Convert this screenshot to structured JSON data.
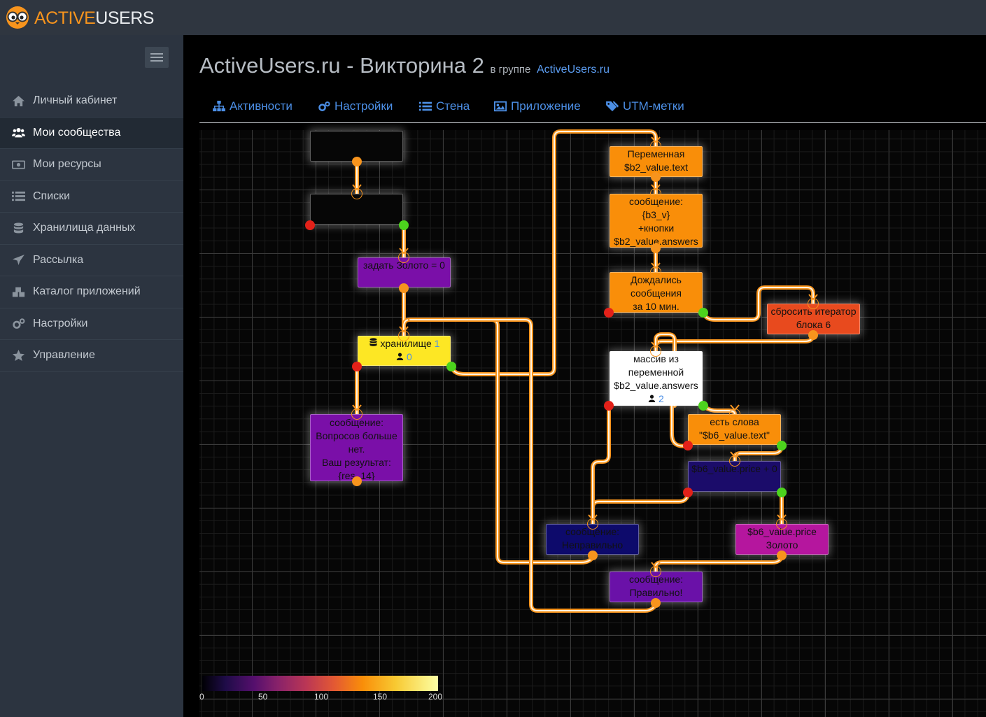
{
  "brand": {
    "part1": "ACTIVE",
    "part2": "USERS"
  },
  "sidebar": {
    "items": [
      {
        "label": "Личный кабинет",
        "icon": "home-icon",
        "active": false
      },
      {
        "label": "Мои сообщества",
        "icon": "users-icon",
        "active": true
      },
      {
        "label": "Мои ресурсы",
        "icon": "money-icon",
        "active": false
      },
      {
        "label": "Списки",
        "icon": "list-icon",
        "active": false
      },
      {
        "label": "Хранилища данных",
        "icon": "database-icon",
        "active": false
      },
      {
        "label": "Рассылка",
        "icon": "plane-icon",
        "active": false
      },
      {
        "label": "Каталог приложений",
        "icon": "cubes-icon",
        "active": false
      },
      {
        "label": "Настройки",
        "icon": "gears-icon",
        "active": false
      },
      {
        "label": "Управление",
        "icon": "star-icon",
        "active": false
      }
    ]
  },
  "header": {
    "title": "ActiveUsers.ru - Викторина 2",
    "group_prefix": "в группе",
    "group_link": "ActiveUsers.ru"
  },
  "tabs": [
    {
      "label": "Активности",
      "icon": "sitemap-icon"
    },
    {
      "label": "Настройки",
      "icon": "gears-icon"
    },
    {
      "label": "Стена",
      "icon": "list-icon"
    },
    {
      "label": "Приложение",
      "icon": "image-icon"
    },
    {
      "label": "UTM-метки",
      "icon": "tags-icon"
    }
  ],
  "nodes": [
    {
      "id": "n1",
      "lines": [],
      "color": "#060606"
    },
    {
      "id": "n2",
      "lines": [],
      "color": "#060606"
    },
    {
      "id": "n3",
      "lines": [
        "задать Золото = 0"
      ],
      "color": "#7a0fa8"
    },
    {
      "id": "n4",
      "lines": [
        "хранилище",
        "0"
      ],
      "count": "1",
      "color": "#fde724"
    },
    {
      "id": "n5",
      "lines": [
        "сообщение:",
        "Вопросов больше",
        "нет.",
        "Ваш результат:",
        "{res_14}"
      ],
      "color": "#7a0fa8"
    },
    {
      "id": "n6",
      "lines": [
        "Переменная",
        "$b2_value.text"
      ],
      "color": "#f98e09"
    },
    {
      "id": "n7",
      "lines": [
        "сообщение:",
        "{b3_v}",
        "+кнопки",
        "$b2_value.answers"
      ],
      "color": "#f98e09"
    },
    {
      "id": "n8",
      "lines": [
        "Дождались",
        "сообщения",
        "за 10 мин."
      ],
      "color": "#f98e09"
    },
    {
      "id": "n9",
      "lines": [
        "сбросить итератор",
        "блока 6"
      ],
      "color": "#e84a1e"
    },
    {
      "id": "n10",
      "lines": [
        "массив из",
        "переменной",
        "$b2_value.answers",
        "2"
      ],
      "color": "#ffffff"
    },
    {
      "id": "n11",
      "lines": [
        "есть слова",
        "\"$b6_value.text\""
      ],
      "color": "#f98e09"
    },
    {
      "id": "n12",
      "lines": [
        "$b6_value.price + 0"
      ],
      "color": "#1b0c6a"
    },
    {
      "id": "n13",
      "lines": [
        "сообщение:",
        "Неправильно"
      ],
      "color": "#0d0a6b"
    },
    {
      "id": "n14",
      "lines": [
        "$b6_value.price",
        "Золото"
      ],
      "color": "#b5169e"
    },
    {
      "id": "n15",
      "lines": [
        "сообщение:",
        "Правильно!"
      ],
      "color": "#6a11a8"
    }
  ],
  "legend": {
    "ticks": [
      "0",
      "50",
      "100",
      "150",
      "200"
    ],
    "range": [
      0,
      200
    ]
  },
  "colors": {
    "accent": "#4c8fe6",
    "wire": "#f7941d",
    "ok": "#4cd31d",
    "fail": "#e32119"
  }
}
